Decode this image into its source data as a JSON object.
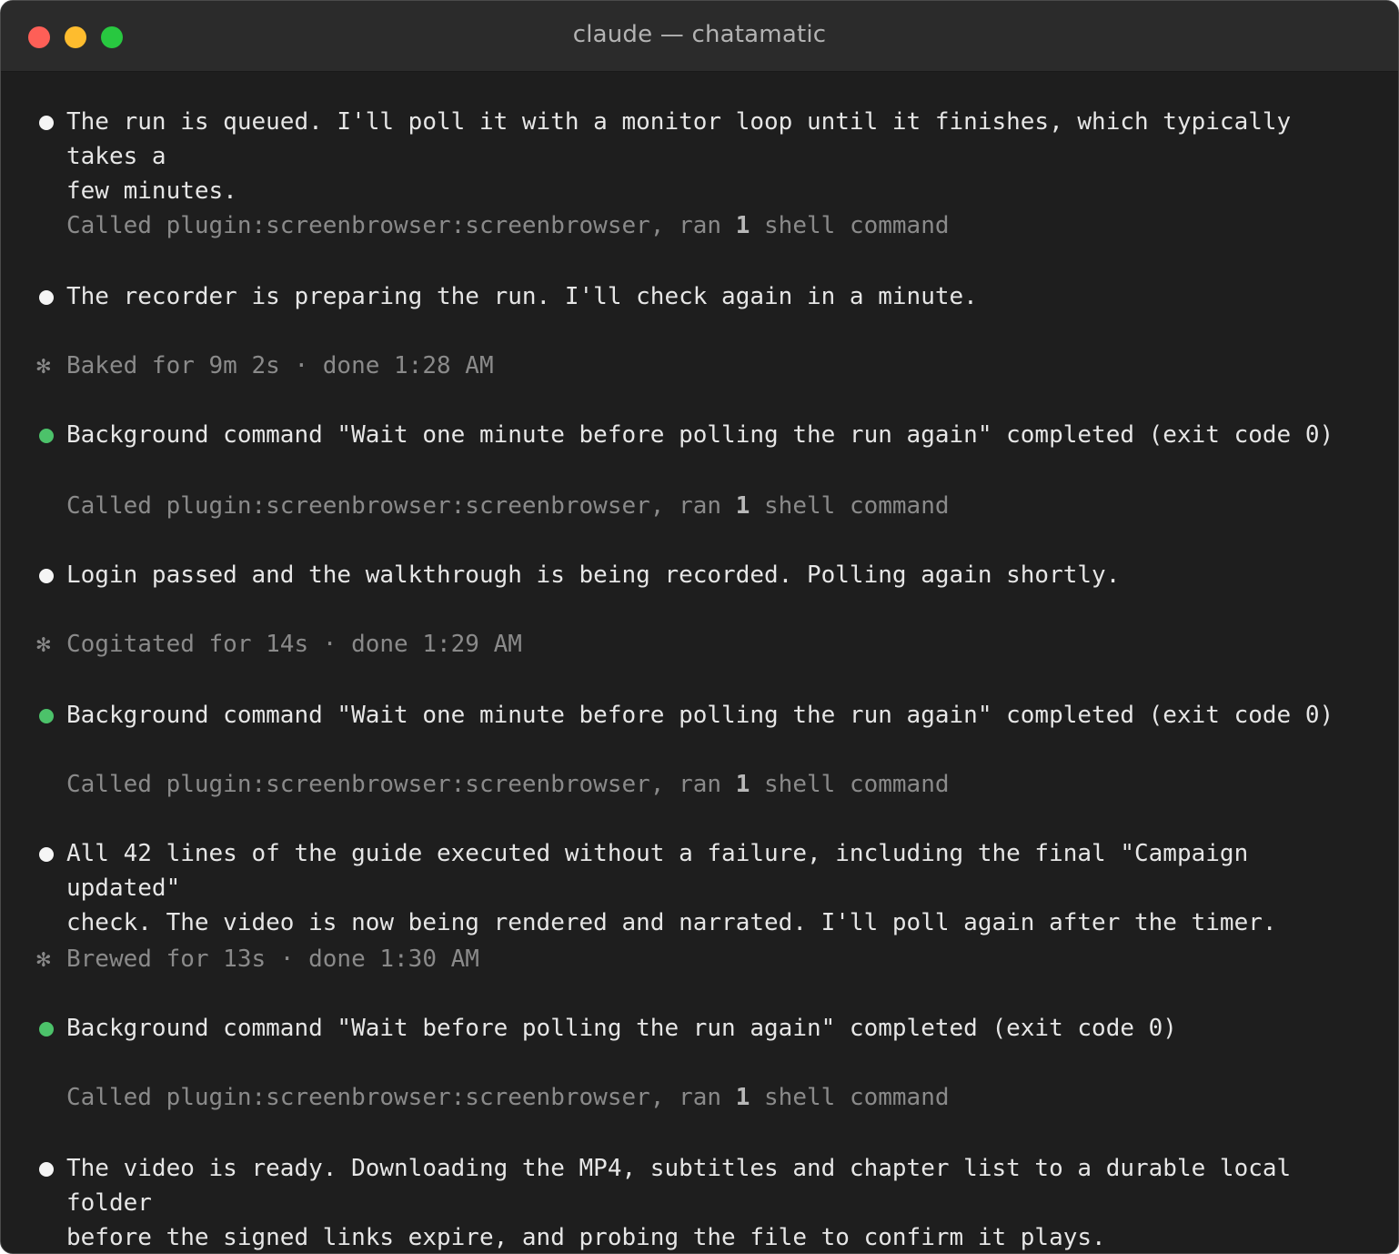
{
  "window": {
    "title": "claude — chatamatic"
  },
  "entries": [
    {
      "kind": "message",
      "bullet": "white",
      "text": "The run is queued. I'll poll it with a monitor loop until it finishes, which typically takes a\nfew minutes."
    },
    {
      "kind": "tool",
      "prefix": "Called plugin:screenbrowser:screenbrowser, ran ",
      "count": "1",
      "suffix": " shell command"
    },
    {
      "kind": "message",
      "bullet": "white",
      "text": "The recorder is preparing the run. I'll check again in a minute."
    },
    {
      "kind": "status",
      "symbol": "✻",
      "text": "Baked for 9m 2s · done 1:28 AM"
    },
    {
      "kind": "message",
      "bullet": "green",
      "text": "Background command \"Wait one minute before polling the run again\" completed (exit code 0)"
    },
    {
      "kind": "tool",
      "prefix": "Called plugin:screenbrowser:screenbrowser, ran ",
      "count": "1",
      "suffix": " shell command"
    },
    {
      "kind": "message",
      "bullet": "white",
      "text": "Login passed and the walkthrough is being recorded. Polling again shortly."
    },
    {
      "kind": "status",
      "symbol": "✻",
      "text": "Cogitated for 14s · done 1:29 AM"
    },
    {
      "kind": "message",
      "bullet": "green",
      "text": "Background command \"Wait one minute before polling the run again\" completed (exit code 0)"
    },
    {
      "kind": "tool",
      "prefix": "Called plugin:screenbrowser:screenbrowser, ran ",
      "count": "1",
      "suffix": " shell command"
    },
    {
      "kind": "message",
      "bullet": "white",
      "text": "All 42 lines of the guide executed without a failure, including the final \"Campaign updated\"\ncheck. The video is now being rendered and narrated. I'll poll again after the timer."
    },
    {
      "kind": "status",
      "symbol": "✻",
      "text": "Brewed for 13s · done 1:30 AM"
    },
    {
      "kind": "message",
      "bullet": "green",
      "text": "Background command \"Wait before polling the run again\" completed (exit code 0)"
    },
    {
      "kind": "tool",
      "prefix": "Called plugin:screenbrowser:screenbrowser, ran ",
      "count": "1",
      "suffix": " shell command"
    },
    {
      "kind": "message",
      "bullet": "white",
      "text": "The video is ready. Downloading the MP4, subtitles and chapter list to a durable local folder\nbefore the signed links expire, and probing the file to confirm it plays."
    }
  ],
  "colors": {
    "background": "#1e1e1e",
    "titlebar": "#2b2b2b",
    "text": "#e6e6e6",
    "dim_text": "#8a8a8a",
    "green_bullet": "#4cc26a",
    "close": "#fe5f57",
    "minimize": "#febc2e",
    "zoom": "#28c840"
  },
  "icons": {
    "close": "close-circle-icon",
    "minimize": "minimize-circle-icon",
    "zoom": "zoom-circle-icon",
    "status": "asterisk-icon",
    "bullet": "bullet-dot-icon"
  }
}
